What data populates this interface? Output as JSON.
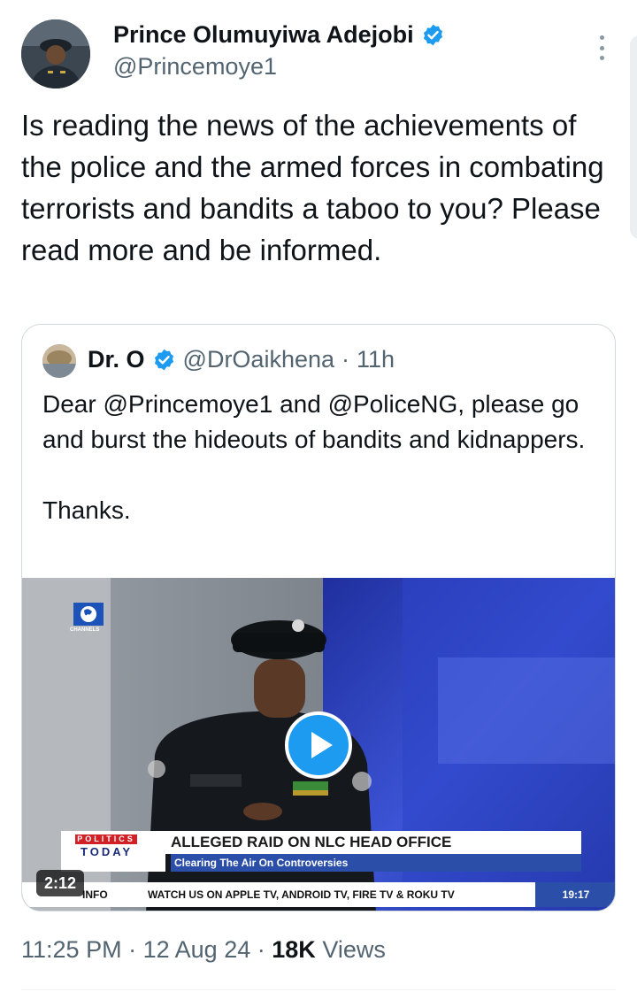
{
  "tweet": {
    "author_name": "Prince Olumuyiwa Adejobi",
    "author_handle": "@Princemoye1",
    "text": "Is reading the news of the achievements of the police and the armed forces in combating terrorists and bandits a taboo to you? Please read more and be informed.",
    "timestamp": "11:25 PM",
    "date": "12 Aug 24",
    "separator": "·",
    "views_count": "18K",
    "views_label": "Views"
  },
  "quote": {
    "author_name": "Dr. O",
    "author_handle": "@DrOaikhena",
    "time_ago": "11h",
    "separator": "·",
    "text": "Dear @Princemoye1 and @PoliceNG, please go and burst the hideouts of bandits and kidnappers.\n\nThanks."
  },
  "video": {
    "duration": "2:12",
    "channel_label": "CHANNELS",
    "program_top": "POLITICS",
    "program_bottom": "TODAY",
    "headline": "ALLEGED RAID ON NLC HEAD OFFICE",
    "subheadline": "Clearing The Air On Controversies",
    "ticker_label": "INFO",
    "ticker_text": "WATCH US ON APPLE TV, ANDROID TV, FIRE TV & ROKU TV",
    "clock": "19:17"
  },
  "colors": {
    "verified_blue": "#1d9bf0",
    "secondary_text": "#536471",
    "primary_text": "#0f1419",
    "border": "#cfd9de"
  },
  "icons": {
    "verified": "verified-badge-icon",
    "more": "more-vertical-icon",
    "play": "play-icon"
  }
}
